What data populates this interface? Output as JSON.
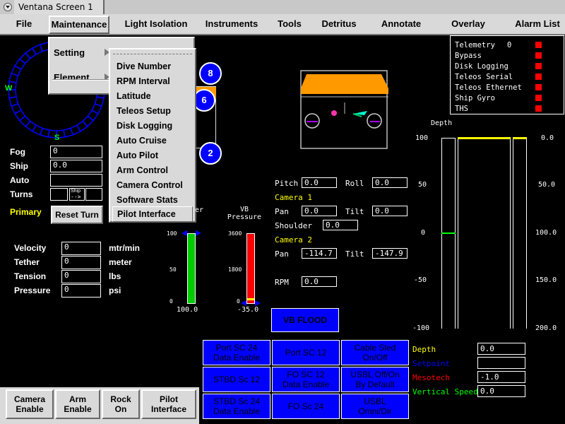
{
  "window": {
    "title": "Ventana Screen 1"
  },
  "menubar": {
    "items": [
      "File",
      "Maintenance",
      "Light Isolation",
      "Instruments",
      "Tools",
      "Detritus",
      "Annotate",
      "Overlay",
      "Alarm List"
    ]
  },
  "maintenance_menu": {
    "items": [
      "Setting",
      "Element"
    ]
  },
  "setting_submenu": {
    "items": [
      "Dive Number",
      "RPM Interval",
      "Latitude",
      "Teleos Setup",
      "Disk Logging",
      "Auto Cruise",
      "Auto Pilot",
      "Arm Control",
      "Camera Control",
      "Software Stats",
      "Pilot Interface"
    ],
    "highlighted": "Pilot Interface"
  },
  "compass": {
    "west": "W",
    "south": "S"
  },
  "camera_badges": [
    "8",
    "6",
    "2"
  ],
  "heading_fields": [
    {
      "label": "Fog",
      "value": "0"
    },
    {
      "label": "Ship",
      "value": "0.0"
    },
    {
      "label": "Auto",
      "value": ""
    },
    {
      "label": "Turns",
      "value": "",
      "ship_label": "Ship",
      "arrow": "-->"
    }
  ],
  "primary": {
    "label": "Primary",
    "reset_button": "Reset Turn"
  },
  "readings": [
    {
      "label": "Velocity",
      "value": "0",
      "unit": "mtr/min"
    },
    {
      "label": "Tether",
      "value": "0",
      "unit": "meter"
    },
    {
      "label": "Tension",
      "value": "0",
      "unit": "lbs"
    },
    {
      "label": "Pressure",
      "value": "0",
      "unit": "psi"
    }
  ],
  "gauge1": {
    "title_tail": "er",
    "ticks": [
      "100",
      "50",
      "0"
    ],
    "value": "100.0",
    "level_fraction": 1.0,
    "color": "#00cc00"
  },
  "gauge2": {
    "title": "VB\nPressure",
    "ticks": [
      "3600",
      "1800",
      "0"
    ],
    "value": "-35.0",
    "color": "#ff0000"
  },
  "vehicle_readout": {
    "pitch": {
      "label": "Pitch",
      "value": "0.0"
    },
    "roll": {
      "label": "Roll",
      "value": "0.0"
    },
    "camera1": "Camera 1",
    "pan1": {
      "label": "Pan",
      "value": "0.0"
    },
    "tilt1": {
      "label": "Tilt",
      "value": "0.0"
    },
    "shoulder": {
      "label": "Shoulder",
      "value": "0.0"
    },
    "camera2": "Camera 2",
    "pan2": {
      "label": "Pan",
      "value": "-114.7"
    },
    "tilt2": {
      "label": "Tilt",
      "value": "-147.9"
    },
    "rpm": {
      "label": "RPM",
      "value": "0.0"
    }
  },
  "vb_flood": "VB FLOOD",
  "telemetry": [
    {
      "label": "Telemetry",
      "value": "0"
    },
    {
      "label": "Bypass"
    },
    {
      "label": "Disk Logging"
    },
    {
      "label": "Teleos Serial"
    },
    {
      "label": "Teleos Ethernet"
    },
    {
      "label": "Ship Gyro"
    },
    {
      "label": "THS"
    }
  ],
  "depth_chart": {
    "title": "Depth",
    "left_ticks": [
      "100",
      "50",
      "0",
      "-50",
      "-100"
    ],
    "right_ticks": [
      "0.0",
      "50.0",
      "100.0",
      "150.0",
      "200.0"
    ]
  },
  "depth_fields": [
    {
      "label": "Depth",
      "value": "0.0",
      "color": "#ffff00"
    },
    {
      "label": "Setpoint",
      "value": "",
      "color": "#0000ff"
    },
    {
      "label": "Mesotech",
      "value": "-1.0",
      "color": "#ff0000"
    },
    {
      "label": "Vertical Speed",
      "value": "0.0",
      "color": "#00ff00"
    }
  ],
  "blue_buttons": [
    [
      "Port SC 24",
      "Data Enable"
    ],
    [
      "Port SC 12",
      ""
    ],
    [
      "Cable Sled",
      "On/Off"
    ],
    [
      "STBD Sc 12",
      ""
    ],
    [
      "FO SC 12",
      "Data Enable"
    ],
    [
      "USBL Off/On",
      "By Default"
    ],
    [
      "STBD Sc 24",
      "Data Enable"
    ],
    [
      "FO Sc 24",
      ""
    ],
    [
      "USBL",
      "Omni/Dir"
    ]
  ],
  "bottom_buttons": [
    [
      "Camera",
      "Enable"
    ],
    [
      "Arm",
      "Enable"
    ],
    [
      "Rock",
      "On"
    ],
    [
      "Pilot",
      "Interface"
    ]
  ],
  "colors": {
    "accent_blue": "#0000ff",
    "menu_gray": "#d9d9d9",
    "alarm_red": "#ff0000",
    "highlight_yellow": "#ffff00"
  }
}
